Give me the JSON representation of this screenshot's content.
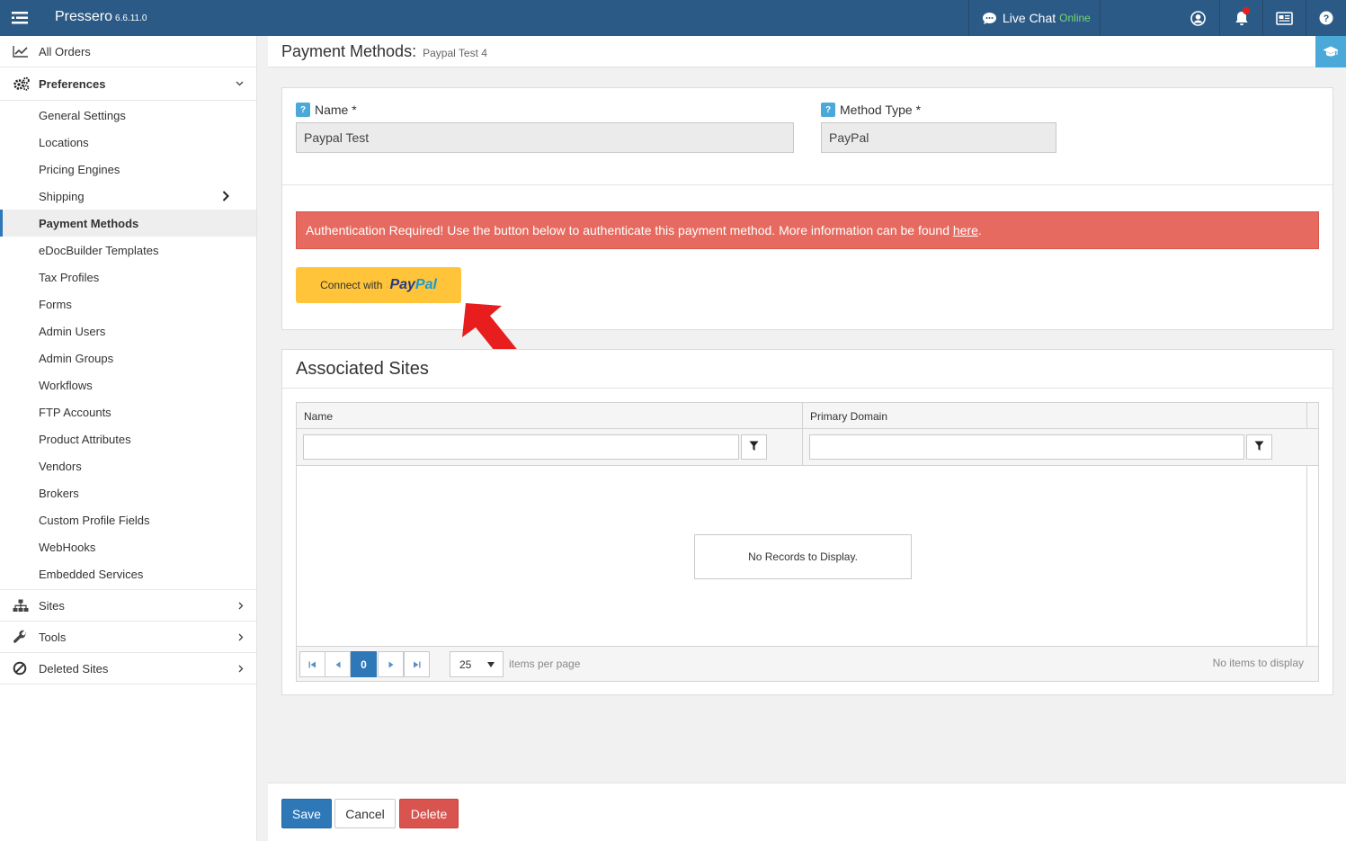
{
  "topbar": {
    "brand": "Pressero",
    "version": "6.6.11.0",
    "live_chat": "Live Chat",
    "chat_status": "Online",
    "bg_color": "#2c5a86"
  },
  "sidebar": {
    "all_orders": "All Orders",
    "preferences": "Preferences",
    "items": [
      {
        "label": "General Settings"
      },
      {
        "label": "Locations"
      },
      {
        "label": "Pricing Engines"
      },
      {
        "label": "Shipping"
      },
      {
        "label": "Payment Methods"
      },
      {
        "label": "eDocBuilder Templates"
      },
      {
        "label": "Tax Profiles"
      },
      {
        "label": "Forms"
      },
      {
        "label": "Admin Users"
      },
      {
        "label": "Admin Groups"
      },
      {
        "label": "Workflows"
      },
      {
        "label": "FTP Accounts"
      },
      {
        "label": "Product Attributes"
      },
      {
        "label": "Vendors"
      },
      {
        "label": "Brokers"
      },
      {
        "label": "Custom Profile Fields"
      },
      {
        "label": "WebHooks"
      },
      {
        "label": "Embedded Services"
      }
    ],
    "sites": "Sites",
    "tools": "Tools",
    "deleted_sites": "Deleted Sites"
  },
  "header": {
    "title": "Payment Methods:",
    "subtitle": "Paypal Test 4"
  },
  "form": {
    "name_label": "Name *",
    "name_value": "Paypal Test",
    "method_type_label": "Method Type *",
    "method_type_value": "PayPal",
    "help_badge": "?",
    "alert_text": "Authentication Required! Use the button below to authenticate this payment method. More information can be found ",
    "alert_link": "here",
    "alert_end": ".",
    "alert_color": "#e66a5f",
    "connect_label": "Connect with",
    "paypal_pay": "Pay",
    "paypal_pal": "Pal"
  },
  "sites": {
    "title": "Associated Sites",
    "columns": [
      "Name",
      "Primary Domain"
    ],
    "empty": "No Records to Display.",
    "current_page": "0",
    "page_size": "25",
    "items_per_page": "items per page",
    "info": "No items to display"
  },
  "footer": {
    "save": "Save",
    "cancel": "Cancel",
    "delete": "Delete"
  }
}
